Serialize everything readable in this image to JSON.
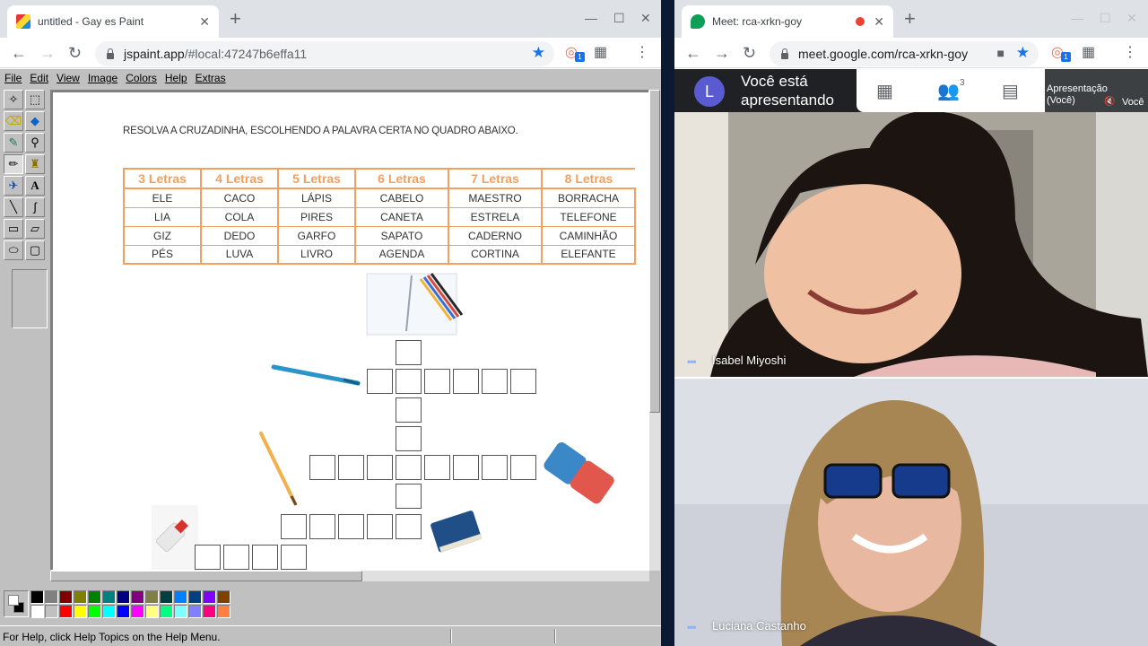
{
  "left_window": {
    "tab_title": "untitled - Gay es Paint",
    "url_host": "jspaint.app",
    "url_path": "/#local:47247b6effa11",
    "extension_badge": "1"
  },
  "right_window": {
    "tab_title": "Meet: rca-xrkn-goy",
    "url": "meet.google.com/rca-xrkn-goy",
    "extension_badge": "1"
  },
  "paint": {
    "menu": [
      "File",
      "Edit",
      "View",
      "Image",
      "Colors",
      "Help",
      "Extras"
    ],
    "status_text": "For Help, click Help Topics on the Help Menu.",
    "palette_top": [
      "#000000",
      "#808080",
      "#800000",
      "#808000",
      "#008000",
      "#008080",
      "#000080",
      "#800080",
      "#808040",
      "#004040",
      "#0080ff",
      "#004080",
      "#8000ff",
      "#804000"
    ],
    "palette_bottom": [
      "#ffffff",
      "#c0c0c0",
      "#ff0000",
      "#ffff00",
      "#00ff00",
      "#00ffff",
      "#0000ff",
      "#ff00ff",
      "#ffff80",
      "#00ff80",
      "#80ffff",
      "#8080ff",
      "#ff0080",
      "#ff8040"
    ]
  },
  "worksheet": {
    "instruction": "RESOLVA A CRUZADINHA, ESCOLHENDO A PALAVRA CERTA NO QUADRO ABAIXO.",
    "headers": [
      "3 Letras",
      "4 Letras",
      "5 Letras",
      "6 Letras",
      "7 Letras",
      "8 Letras"
    ],
    "rows": [
      [
        "ELE",
        "CACO",
        "LÁPIS",
        "CABELO",
        "MAESTRO",
        "BORRACHA"
      ],
      [
        "LIA",
        "COLA",
        "PIRES",
        "CANETA",
        "ESTRELA",
        "TELEFONE"
      ],
      [
        "GIZ",
        "DEDO",
        "GARFO",
        "SAPATO",
        "CADERNO",
        "CAMINHÃO"
      ],
      [
        "PÉS",
        "LUVA",
        "LIVRO",
        "AGENDA",
        "CORTINA",
        "ELEFANTE"
      ]
    ]
  },
  "meet": {
    "avatar_letter": "L",
    "presenting_line1": "Você está",
    "presenting_line2": "apresentando",
    "people_count": "3",
    "presentation_label": "Apresentação (Você)",
    "you_label": "Você",
    "participants": [
      {
        "name": "Isabel Miyoshi"
      },
      {
        "name": "Luciana Castanho"
      }
    ]
  }
}
